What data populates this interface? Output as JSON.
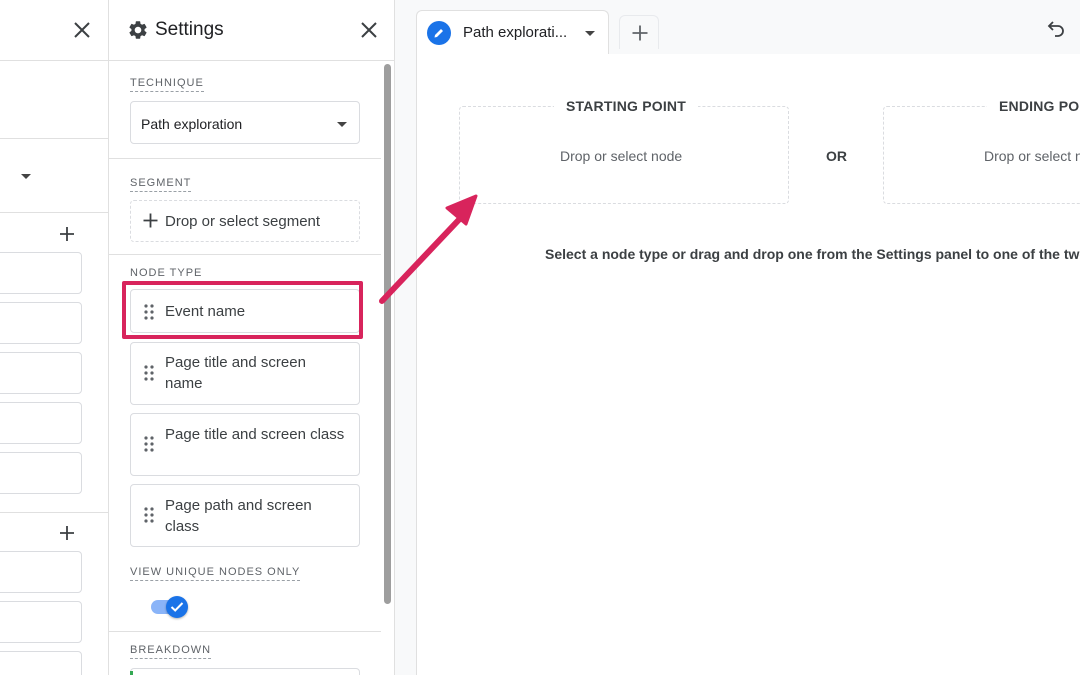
{
  "settings": {
    "title": "Settings",
    "technique": {
      "label": "TECHNIQUE",
      "value": "Path exploration"
    },
    "segment": {
      "label": "SEGMENT",
      "placeholder": "Drop or select segment"
    },
    "node_type": {
      "label": "NODE TYPE",
      "items": [
        {
          "label": "Event name"
        },
        {
          "label": "Page title and screen name"
        },
        {
          "label": "Page title and screen class"
        },
        {
          "label": "Page path and screen class"
        }
      ]
    },
    "unique_nodes": {
      "label": "VIEW UNIQUE NODES ONLY",
      "enabled": true
    },
    "breakdown": {
      "label": "BREAKDOWN"
    }
  },
  "tabs": {
    "active_label": "Path explorati..."
  },
  "canvas": {
    "starting_point": {
      "title": "STARTING POINT",
      "placeholder": "Drop or select node"
    },
    "or_label": "OR",
    "ending_point": {
      "title": "ENDING POINT",
      "placeholder": "Drop or select node"
    },
    "instruction": "Select a node type or drag and drop one from the Settings panel to one of the two"
  },
  "colors": {
    "accent_blue": "#1a73e8",
    "highlight_pink": "#d8245c"
  }
}
